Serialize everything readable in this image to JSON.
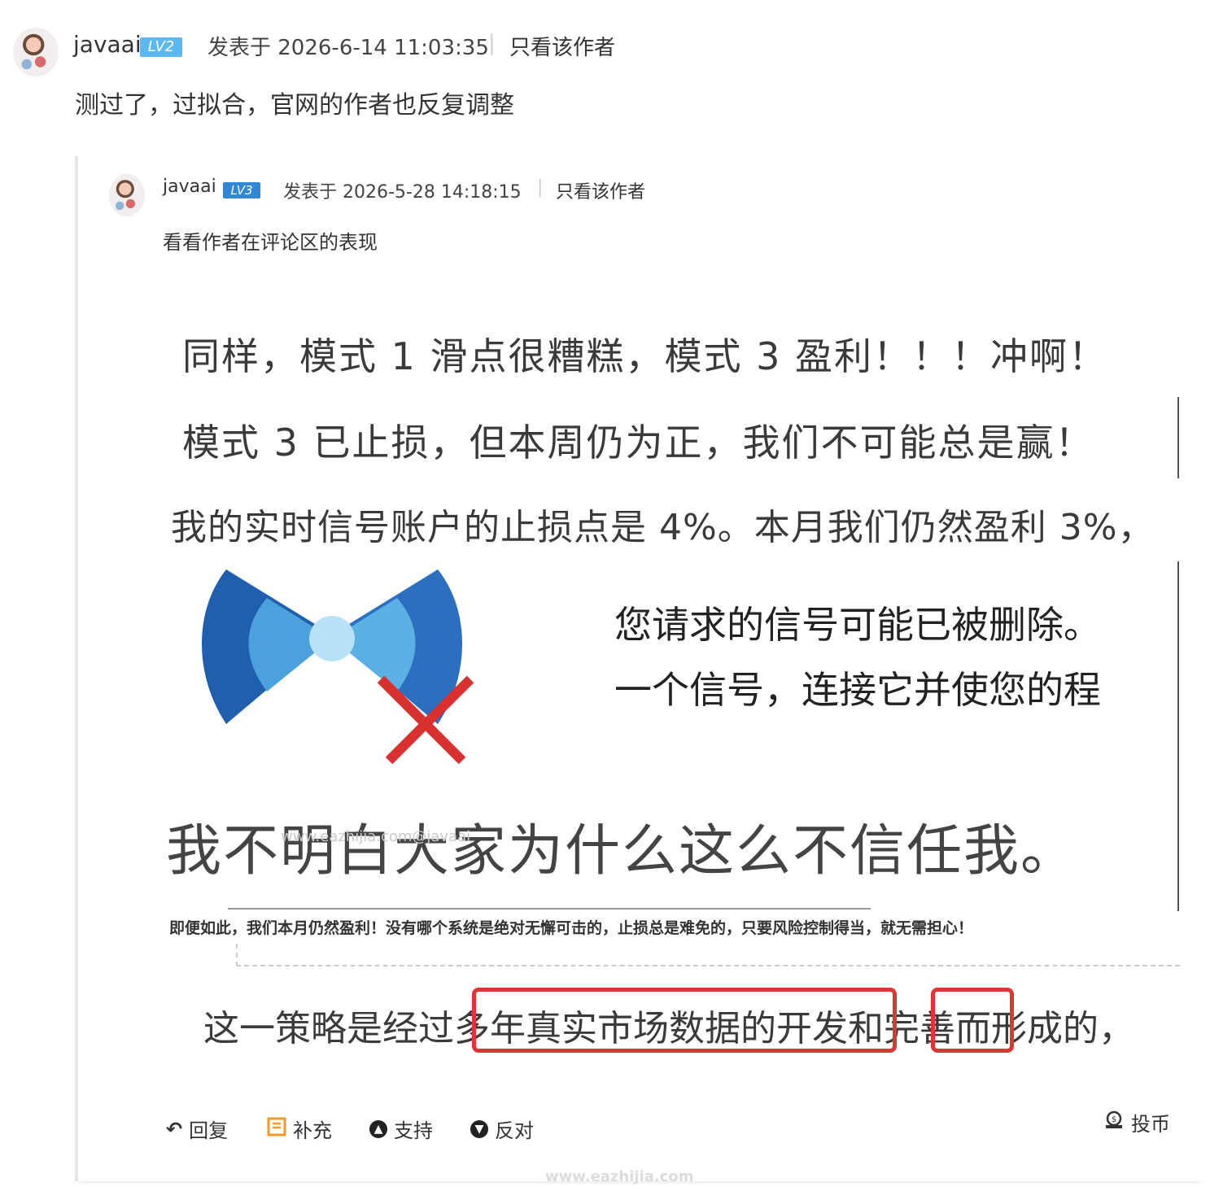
{
  "post": {
    "author": "javaai",
    "level": "LV2",
    "posted_at": "发表于 2026-6-14 11:03:35",
    "separator": "|",
    "only_author": "只看该作者",
    "body": "测过了，过拟合，官网的作者也反复调整"
  },
  "quoted": {
    "author": "javaai",
    "level": "LV3",
    "posted_at": "发表于 2026-5-28 14:18:15",
    "separator": "|",
    "only_author": "只看该作者",
    "body": "看看作者在评论区的表现",
    "image": {
      "line1": "同样，模式 1 滑点很糟糕，模式 3 盈利！！！冲啊！",
      "line2": "模式 3 已止损，但本周仍为正，我们不可能总是赢！",
      "line3": "我的实时信号账户的止损点是 4%。本月我们仍然盈利 3%，",
      "line4a": "您请求的信号可能已被删除。",
      "line4b": "一个信号，连接它并使您的程",
      "line5": "我不明白大家为什么这么不信任我。",
      "watermark_inner": "www.eazhijia.com@javaai",
      "line6": "即便如此，我们本月仍然盈利！没有哪个系统是绝对无懈可击的，止损总是难免的，只要风险控制得当，就无需担心！",
      "line7": "这一策略是经过多年真实市场数据的开发和完善而形成的，"
    },
    "actions": {
      "reply": "回复",
      "supplement": "补充",
      "support": "支持",
      "oppose": "反对",
      "coin": "投币"
    }
  },
  "footer_watermark": "www.eazhijia.com",
  "colors": {
    "level_badge": "#5cb8f0",
    "highlight_box": "#e03535",
    "supplement_icon": "#f29b2b"
  }
}
